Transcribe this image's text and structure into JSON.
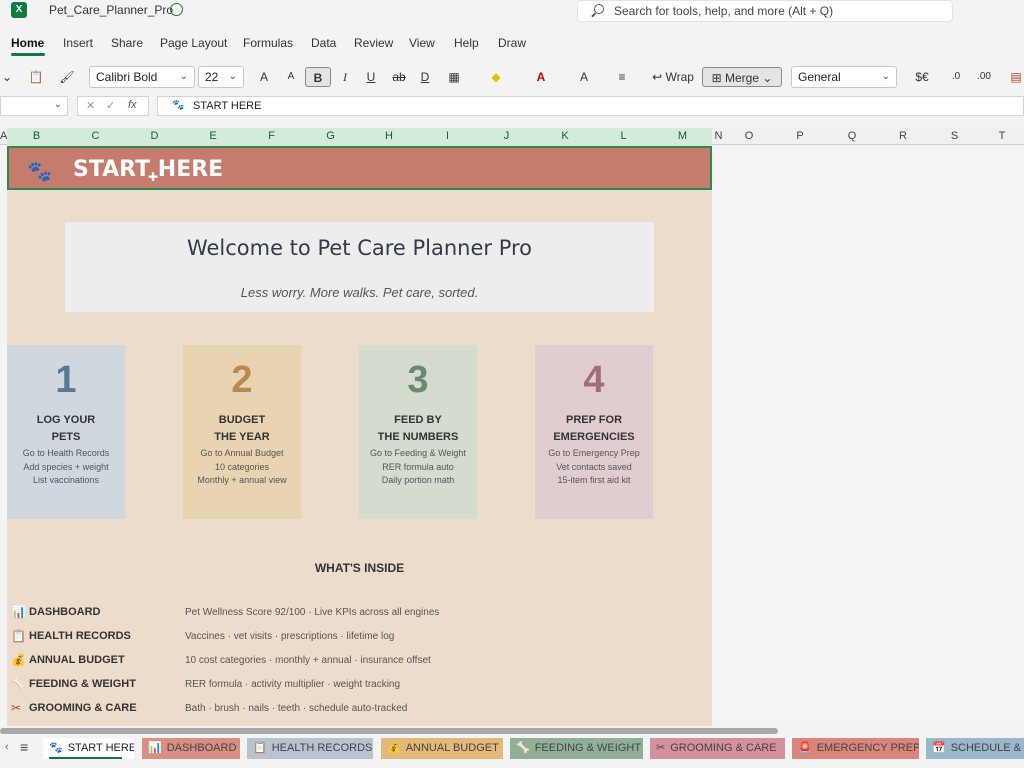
{
  "window": {
    "title": "Pet_Care_Planner_Pro"
  },
  "search": {
    "placeholder": "Search for tools, help, and more (Alt + Q)"
  },
  "menu": [
    "Home",
    "Insert",
    "Share",
    "Page Layout",
    "Formulas",
    "Data",
    "Review",
    "View",
    "Help",
    "Draw"
  ],
  "ribbon": {
    "font_name": "Calibri Bold",
    "font_size": "22",
    "bold_label": "B",
    "italic_label": "I",
    "underline_label": "U",
    "strike_label": "ab",
    "wrap_label": "Wrap",
    "merge_label": "Merge",
    "number_format": "General",
    "currency_label": "$€"
  },
  "formula_bar": {
    "fx": "fx",
    "value": "START HERE"
  },
  "columns": [
    "A",
    "B",
    "C",
    "D",
    "E",
    "F",
    "G",
    "H",
    "I",
    "J",
    "K",
    "L",
    "M",
    "N",
    "O",
    "P",
    "Q",
    "R",
    "S",
    "T"
  ],
  "banner": {
    "title": "START HERE"
  },
  "welcome": {
    "heading": "Welcome to Pet Care Planner Pro",
    "tagline": "Less worry. More walks. Pet care, sorted."
  },
  "steps": [
    {
      "num": "1",
      "title1": "LOG YOUR",
      "title2": "PETS",
      "d1": "Go to Health Records",
      "d2": "Add species + weight",
      "d3": "List vaccinations",
      "bg": "#cfd7df",
      "color": "#5d7891"
    },
    {
      "num": "2",
      "title1": "BUDGET",
      "title2": "THE YEAR",
      "d1": "Go to Annual Budget",
      "d2": "10 categories",
      "d3": "Monthly + annual view",
      "bg": "#e9d4b1",
      "color": "#b98a4e"
    },
    {
      "num": "3",
      "title1": "FEED BY",
      "title2": "THE NUMBERS",
      "d1": "Go to Feeding & Weight",
      "d2": "RER formula auto",
      "d3": "Daily portion math",
      "bg": "#d3dccf",
      "color": "#698a70"
    },
    {
      "num": "4",
      "title1": "PREP FOR",
      "title2": "EMERGENCIES",
      "d1": "Go to Emergency Prep",
      "d2": "Vet contacts saved",
      "d3": "15-item first aid kit",
      "bg": "#dfcdd0",
      "color": "#9e6f78"
    }
  ],
  "inside": {
    "heading": "WHAT'S INSIDE",
    "items": [
      {
        "name": "DASHBOARD",
        "desc": "Pet Wellness Score 92/100 · Live KPIs across all engines",
        "icon": "📊"
      },
      {
        "name": "HEALTH RECORDS",
        "desc": "Vaccines · vet visits · prescriptions · lifetime log",
        "icon": "📋"
      },
      {
        "name": "ANNUAL BUDGET",
        "desc": "10 cost categories · monthly + annual · insurance offset",
        "icon": "💰"
      },
      {
        "name": "FEEDING & WEIGHT",
        "desc": "RER formula · activity multiplier · weight tracking",
        "icon": "🦴"
      },
      {
        "name": "GROOMING & CARE",
        "desc": "Bath · brush · nails · teeth · schedule auto-tracked",
        "icon": "✂"
      }
    ]
  },
  "tabs": [
    {
      "label": "START HERE",
      "icon": "🐾",
      "color": "#ffffff"
    },
    {
      "label": "DASHBOARD",
      "icon": "📊",
      "color": "#d98e83"
    },
    {
      "label": "HEALTH RECORDS",
      "icon": "📋",
      "color": "#b8c3d0"
    },
    {
      "label": "ANNUAL BUDGET",
      "icon": "💰",
      "color": "#e3b97a"
    },
    {
      "label": "FEEDING & WEIGHT",
      "icon": "🦴",
      "color": "#8fb096"
    },
    {
      "label": "GROOMING & CARE",
      "icon": "✂",
      "color": "#d4919c"
    },
    {
      "label": "EMERGENCY PREP",
      "icon": "🚨",
      "color": "#d9857c"
    },
    {
      "label": "SCHEDULE & R",
      "icon": "📅",
      "color": "#9bb7cc"
    }
  ]
}
